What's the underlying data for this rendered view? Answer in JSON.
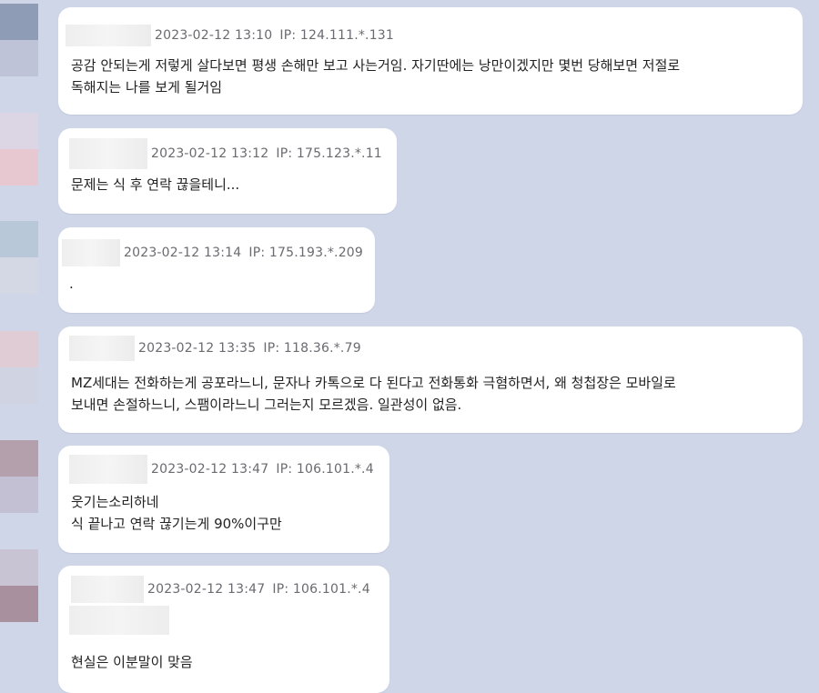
{
  "comments": [
    {
      "timestamp": "2023-02-12 13:10",
      "ip": "IP: 124.111.*.131",
      "text": "공감 안되는게 저렇게 살다보면 평생 손해만 보고 사는거임. 자기딴에는 낭만이겠지만 몇번 당해보면 저절로\n독해지는 나를 보게 될거임"
    },
    {
      "timestamp": "2023-02-12 13:12",
      "ip": "IP: 175.123.*.11",
      "text": "문제는 식 후 연락 끊을테니..."
    },
    {
      "timestamp": "2023-02-12 13:14",
      "ip": "IP: 175.193.*.209",
      "text": "."
    },
    {
      "timestamp": "2023-02-12 13:35",
      "ip": "IP: 118.36.*.79",
      "text": "MZ세대는 전화하는게 공포라느니, 문자나 카톡으로 다 된다고 전화통화 극혐하면서, 왜 청첩장은 모바일로\n보내면 손절하느니, 스팸이라느니 그러는지 모르겠음. 일관성이 없음."
    },
    {
      "timestamp": "2023-02-12 13:47",
      "ip": "IP: 106.101.*.4",
      "text": "웃기는소리하네\n식 끝나고 연락 끊기는게 90%이구만"
    },
    {
      "timestamp": "2023-02-12 13:47",
      "ip": "IP: 106.101.*.4",
      "text": "현실은 이분말이 맞음"
    }
  ],
  "colors": {
    "background": "#cfd6e8",
    "bubble": "#ffffff",
    "meta_text": "#6a6a70",
    "body_text": "#222222"
  }
}
